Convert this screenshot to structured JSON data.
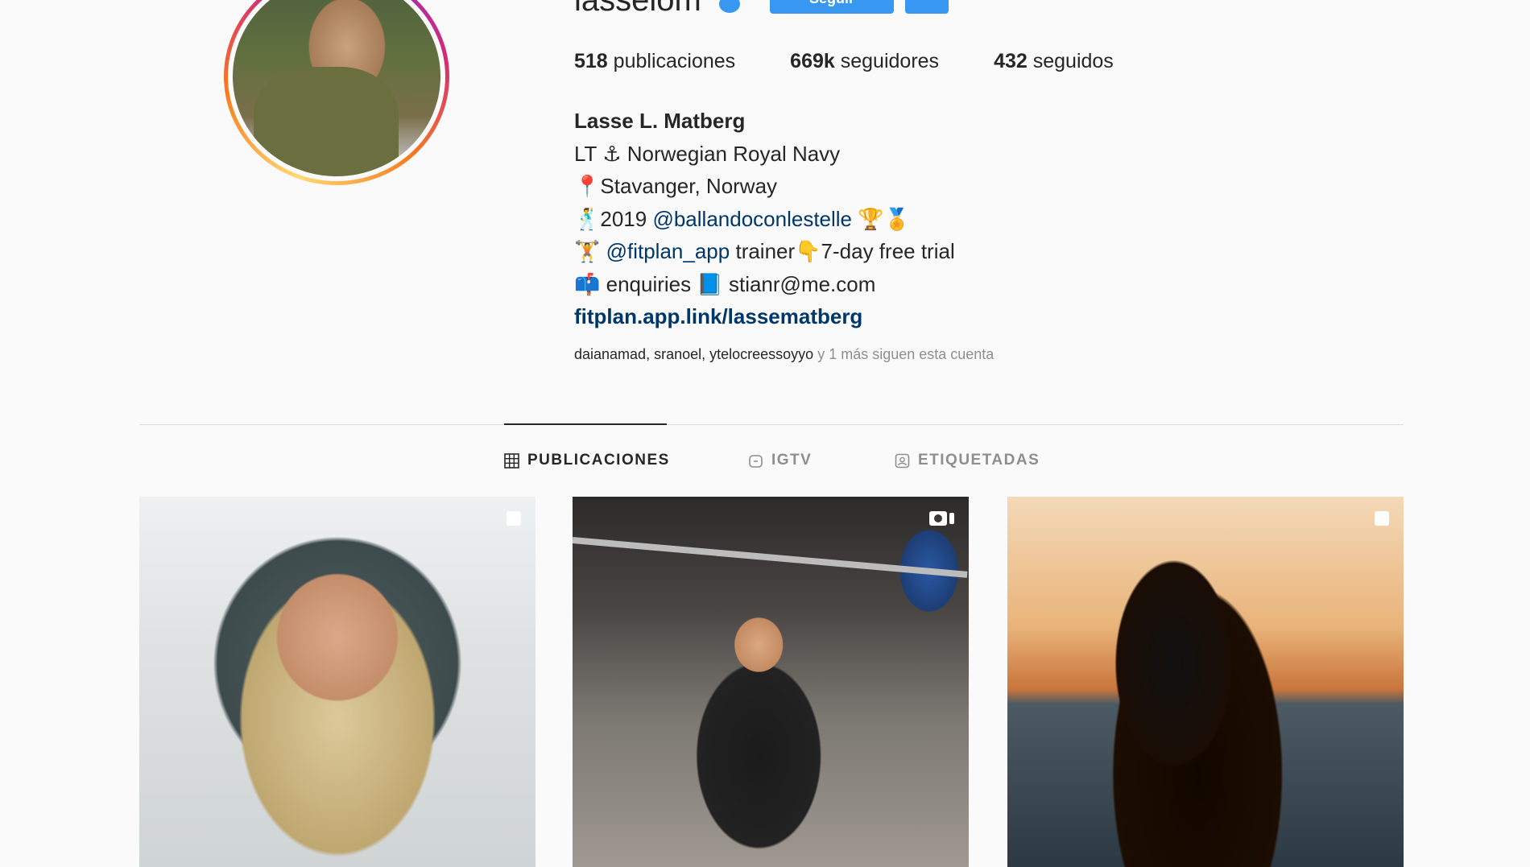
{
  "profile": {
    "username": "lasselom",
    "follow_label": "Seguir"
  },
  "stats": {
    "posts_count": "518",
    "posts_label": "publicaciones",
    "followers_count": "669k",
    "followers_label": "seguidores",
    "following_count": "432",
    "following_label": "seguidos"
  },
  "bio": {
    "name": "Lasse L. Matberg",
    "line1_prefix": "LT",
    "line1_text": "Norwegian Royal Navy",
    "line2_text": "Stavanger, Norway",
    "line3_text": "2019",
    "line3_mention": "@ballandoconlestelle",
    "line4_mention": "@fitplan_app",
    "line4_text_a": "trainer",
    "line4_text_b": "7-day free trial",
    "line5_text_a": "enquiries",
    "line5_text_b": "stianr@me.com",
    "link": "fitplan.app.link/lassematberg"
  },
  "followed_by": {
    "users": "daianamad, sranoel, ytelocreessoyyo",
    "suffix": "y 1 más siguen esta cuenta"
  },
  "tabs": [
    {
      "label": "PUBLICACIONES",
      "icon": "grid-icon",
      "active": true
    },
    {
      "label": "IGTV",
      "icon": "igtv-icon",
      "active": false
    },
    {
      "label": "ETIQUETADAS",
      "icon": "tagged-icon",
      "active": false
    }
  ],
  "posts": [
    {
      "type": "image",
      "icon": "multi-image-icon"
    },
    {
      "type": "video",
      "icon": "video-icon"
    },
    {
      "type": "image",
      "icon": "multi-image-icon"
    }
  ],
  "colors": {
    "accent": "#3897f0",
    "link": "#00376b",
    "text": "#262626",
    "muted": "#8e8e8e",
    "background": "#fafafa"
  }
}
